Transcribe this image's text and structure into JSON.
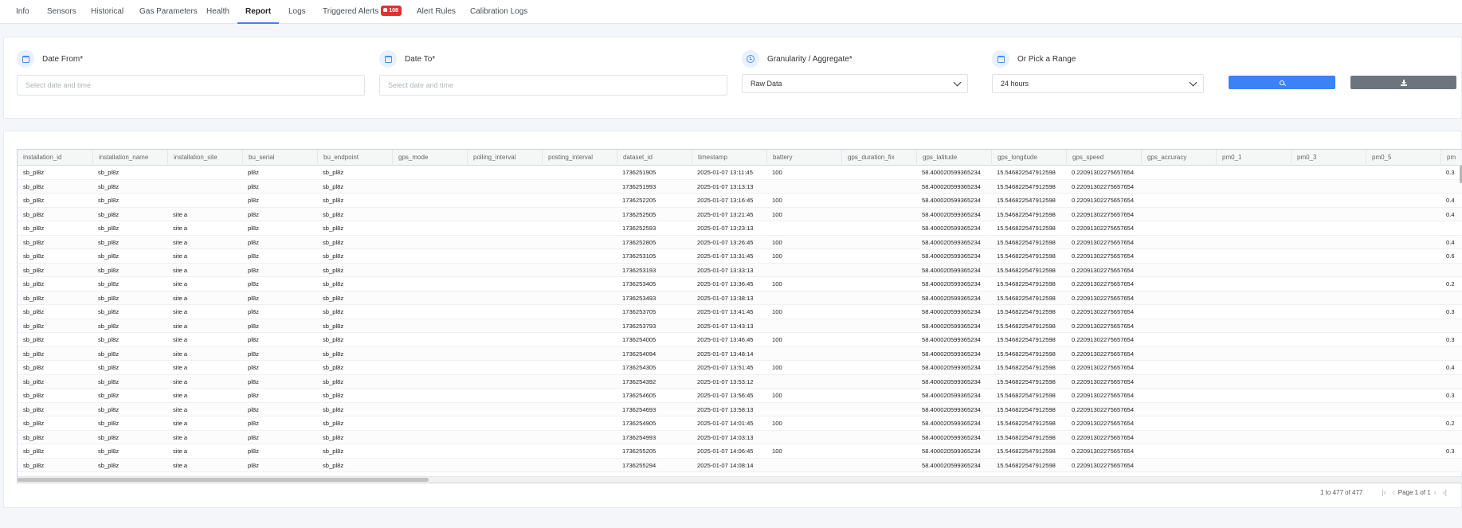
{
  "tabs": [
    {
      "label": "Info"
    },
    {
      "label": "Sensors"
    },
    {
      "label": "Historical"
    },
    {
      "label": "Gas Parameters"
    },
    {
      "label": "Health"
    },
    {
      "label": "Report",
      "active": true
    },
    {
      "label": "Logs"
    },
    {
      "label": "Triggered Alerts",
      "badge": "108"
    },
    {
      "label": "Alert Rules"
    },
    {
      "label": "Calibration Logs"
    }
  ],
  "filters": {
    "date_from": {
      "label": "Date From*",
      "placeholder": "Select date and time",
      "icon": "calendar-icon"
    },
    "date_to": {
      "label": "Date To*",
      "placeholder": "Select date and time",
      "icon": "calendar-icon"
    },
    "granularity": {
      "label": "Granularity / Aggregate*",
      "value": "Raw Data",
      "icon": "clock-icon"
    },
    "range": {
      "label": "Or Pick a Range",
      "value": "24 hours",
      "icon": "calendar-icon"
    },
    "search_button": {
      "icon": "search-icon",
      "color": "#3b82f6"
    },
    "download_button": {
      "icon": "download-icon",
      "color": "#6c757d"
    }
  },
  "grid": {
    "columns": [
      "installation_id",
      "installation_name",
      "installation_site",
      "bu_serial",
      "bu_endpoint",
      "gps_mode",
      "polling_interval",
      "posting_interval",
      "dataset_id",
      "timestamp",
      "battery",
      "gps_duration_fix",
      "gps_latitude",
      "gps_longitude",
      "gps_speed",
      "gps_accuracy",
      "pm0_1",
      "pm0_3",
      "pm0_5",
      "pm"
    ],
    "rows": [
      [
        "sb_pl8z",
        "sb_pl8z",
        "",
        "pl8z",
        "sb_pl8z",
        "",
        "",
        "",
        "1736251905",
        "2025-01-07 13:11:45",
        "100",
        "",
        "58.400020599365234",
        "15.546822547912598",
        "0.22091302275657654",
        "",
        "",
        "",
        "",
        "0.3"
      ],
      [
        "sb_pl8z",
        "sb_pl8z",
        "",
        "pl8z",
        "sb_pl8z",
        "",
        "",
        "",
        "1736251993",
        "2025-01-07 13:13:13",
        "",
        "",
        "58.400020599365234",
        "15.546822547912598",
        "0.22091302275657654",
        "",
        "",
        "",
        "",
        ""
      ],
      [
        "sb_pl8z",
        "sb_pl8z",
        "",
        "pl8z",
        "sb_pl8z",
        "",
        "",
        "",
        "1736252205",
        "2025-01-07 13:16:45",
        "100",
        "",
        "58.400020599365234",
        "15.546822547912598",
        "0.22091302275657654",
        "",
        "",
        "",
        "",
        "0.4"
      ],
      [
        "sb_pl8z",
        "sb_pl8z",
        "site a",
        "pl8z",
        "sb_pl8z",
        "",
        "",
        "",
        "1736252505",
        "2025-01-07 13:21:45",
        "100",
        "",
        "58.400020599365234",
        "15.546822547912598",
        "0.22091302275657654",
        "",
        "",
        "",
        "",
        "0.4"
      ],
      [
        "sb_pl8z",
        "sb_pl8z",
        "site a",
        "pl8z",
        "sb_pl8z",
        "",
        "",
        "",
        "1736252593",
        "2025-01-07 13:23:13",
        "",
        "",
        "58.400020599365234",
        "15.546822547912598",
        "0.22091302275657654",
        "",
        "",
        "",
        "",
        ""
      ],
      [
        "sb_pl8z",
        "sb_pl8z",
        "site a",
        "pl8z",
        "sb_pl8z",
        "",
        "",
        "",
        "1736252805",
        "2025-01-07 13:26:45",
        "100",
        "",
        "58.400020599365234",
        "15.546822547912598",
        "0.22091302275657654",
        "",
        "",
        "",
        "",
        "0.4"
      ],
      [
        "sb_pl8z",
        "sb_pl8z",
        "site a",
        "pl8z",
        "sb_pl8z",
        "",
        "",
        "",
        "1736253105",
        "2025-01-07 13:31:45",
        "100",
        "",
        "58.400020599365234",
        "15.546822547912598",
        "0.22091302275657654",
        "",
        "",
        "",
        "",
        "0.6"
      ],
      [
        "sb_pl8z",
        "sb_pl8z",
        "site a",
        "pl8z",
        "sb_pl8z",
        "",
        "",
        "",
        "1736253193",
        "2025-01-07 13:33:13",
        "",
        "",
        "58.400020599365234",
        "15.546822547912598",
        "0.22091302275657654",
        "",
        "",
        "",
        "",
        ""
      ],
      [
        "sb_pl8z",
        "sb_pl8z",
        "site a",
        "pl8z",
        "sb_pl8z",
        "",
        "",
        "",
        "1736253405",
        "2025-01-07 13:36:45",
        "100",
        "",
        "58.400020599365234",
        "15.546822547912598",
        "0.22091302275657654",
        "",
        "",
        "",
        "",
        "0.2"
      ],
      [
        "sb_pl8z",
        "sb_pl8z",
        "site a",
        "pl8z",
        "sb_pl8z",
        "",
        "",
        "",
        "1736253493",
        "2025-01-07 13:38:13",
        "",
        "",
        "58.400020599365234",
        "15.546822547912598",
        "0.22091302275657654",
        "",
        "",
        "",
        "",
        ""
      ],
      [
        "sb_pl8z",
        "sb_pl8z",
        "site a",
        "pl8z",
        "sb_pl8z",
        "",
        "",
        "",
        "1736253705",
        "2025-01-07 13:41:45",
        "100",
        "",
        "58.400020599365234",
        "15.546822547912598",
        "0.22091302275657654",
        "",
        "",
        "",
        "",
        "0.3"
      ],
      [
        "sb_pl8z",
        "sb_pl8z",
        "site a",
        "pl8z",
        "sb_pl8z",
        "",
        "",
        "",
        "1736253793",
        "2025-01-07 13:43:13",
        "",
        "",
        "58.400020599365234",
        "15.546822547912598",
        "0.22091302275657654",
        "",
        "",
        "",
        "",
        ""
      ],
      [
        "sb_pl8z",
        "sb_pl8z",
        "site a",
        "pl8z",
        "sb_pl8z",
        "",
        "",
        "",
        "1736254005",
        "2025-01-07 13:46:45",
        "100",
        "",
        "58.400020599365234",
        "15.546822547912598",
        "0.22091302275657654",
        "",
        "",
        "",
        "",
        "0.3"
      ],
      [
        "sb_pl8z",
        "sb_pl8z",
        "site a",
        "pl8z",
        "sb_pl8z",
        "",
        "",
        "",
        "1736254094",
        "2025-01-07 13:48:14",
        "",
        "",
        "58.400020599365234",
        "15.546822547912598",
        "0.22091302275657654",
        "",
        "",
        "",
        "",
        ""
      ],
      [
        "sb_pl8z",
        "sb_pl8z",
        "site a",
        "pl8z",
        "sb_pl8z",
        "",
        "",
        "",
        "1736254305",
        "2025-01-07 13:51:45",
        "100",
        "",
        "58.400020599365234",
        "15.546822547912598",
        "0.22091302275657654",
        "",
        "",
        "",
        "",
        "0.4"
      ],
      [
        "sb_pl8z",
        "sb_pl8z",
        "site a",
        "pl8z",
        "sb_pl8z",
        "",
        "",
        "",
        "1736254392",
        "2025-01-07 13:53:12",
        "",
        "",
        "58.400020599365234",
        "15.546822547912598",
        "0.22091302275657654",
        "",
        "",
        "",
        "",
        ""
      ],
      [
        "sb_pl8z",
        "sb_pl8z",
        "site a",
        "pl8z",
        "sb_pl8z",
        "",
        "",
        "",
        "1736254605",
        "2025-01-07 13:56:45",
        "100",
        "",
        "58.400020599365234",
        "15.546822547912598",
        "0.22091302275657654",
        "",
        "",
        "",
        "",
        "0.3"
      ],
      [
        "sb_pl8z",
        "sb_pl8z",
        "site a",
        "pl8z",
        "sb_pl8z",
        "",
        "",
        "",
        "1736254693",
        "2025-01-07 13:58:13",
        "",
        "",
        "58.400020599365234",
        "15.546822547912598",
        "0.22091302275657654",
        "",
        "",
        "",
        "",
        ""
      ],
      [
        "sb_pl8z",
        "sb_pl8z",
        "site a",
        "pl8z",
        "sb_pl8z",
        "",
        "",
        "",
        "1736254905",
        "2025-01-07 14:01:45",
        "100",
        "",
        "58.400020599365234",
        "15.546822547912598",
        "0.22091302275657654",
        "",
        "",
        "",
        "",
        "0.2"
      ],
      [
        "sb_pl8z",
        "sb_pl8z",
        "site a",
        "pl8z",
        "sb_pl8z",
        "",
        "",
        "",
        "1736254993",
        "2025-01-07 14:03:13",
        "",
        "",
        "58.400020599365234",
        "15.546822547912598",
        "0.22091302275657654",
        "",
        "",
        "",
        "",
        ""
      ],
      [
        "sb_pl8z",
        "sb_pl8z",
        "site a",
        "pl8z",
        "sb_pl8z",
        "",
        "",
        "",
        "1736255205",
        "2025-01-07 14:06:45",
        "100",
        "",
        "58.400020599365234",
        "15.546822547912598",
        "0.22091302275657654",
        "",
        "",
        "",
        "",
        "0.3"
      ],
      [
        "sb_pl8z",
        "sb_pl8z",
        "site a",
        "pl8z",
        "sb_pl8z",
        "",
        "",
        "",
        "1736255294",
        "2025-01-07 14:08:14",
        "",
        "",
        "58.400020599365234",
        "15.546822547912598",
        "0.22091302275657654",
        "",
        "",
        "",
        "",
        ""
      ]
    ]
  },
  "pagination": {
    "range": "1 to 477 of 477",
    "page": "Page 1 of 1",
    "first": "|‹",
    "prev": "‹",
    "next": "›",
    "last": "›|"
  }
}
